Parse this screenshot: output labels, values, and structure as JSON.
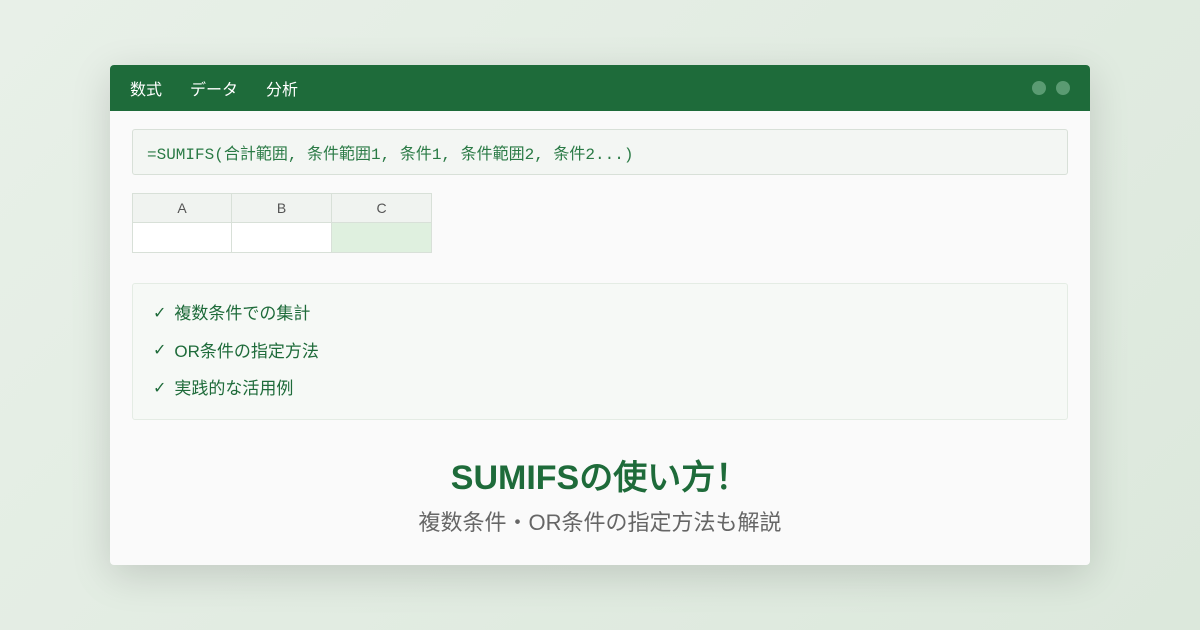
{
  "titlebar": {
    "menu": [
      "数式",
      "データ",
      "分析"
    ]
  },
  "formula_bar": "=SUMIFS(合計範囲, 条件範囲1, 条件1, 条件範囲2, 条件2...)",
  "sheet": {
    "columns": [
      "A",
      "B",
      "C"
    ]
  },
  "features": {
    "items": [
      "複数条件での集計",
      "OR条件の指定方法",
      "実践的な活用例"
    ],
    "check": "✓"
  },
  "title": {
    "main": "SUMIFSの使い方！",
    "sub": "複数条件・OR条件の指定方法も解説"
  }
}
